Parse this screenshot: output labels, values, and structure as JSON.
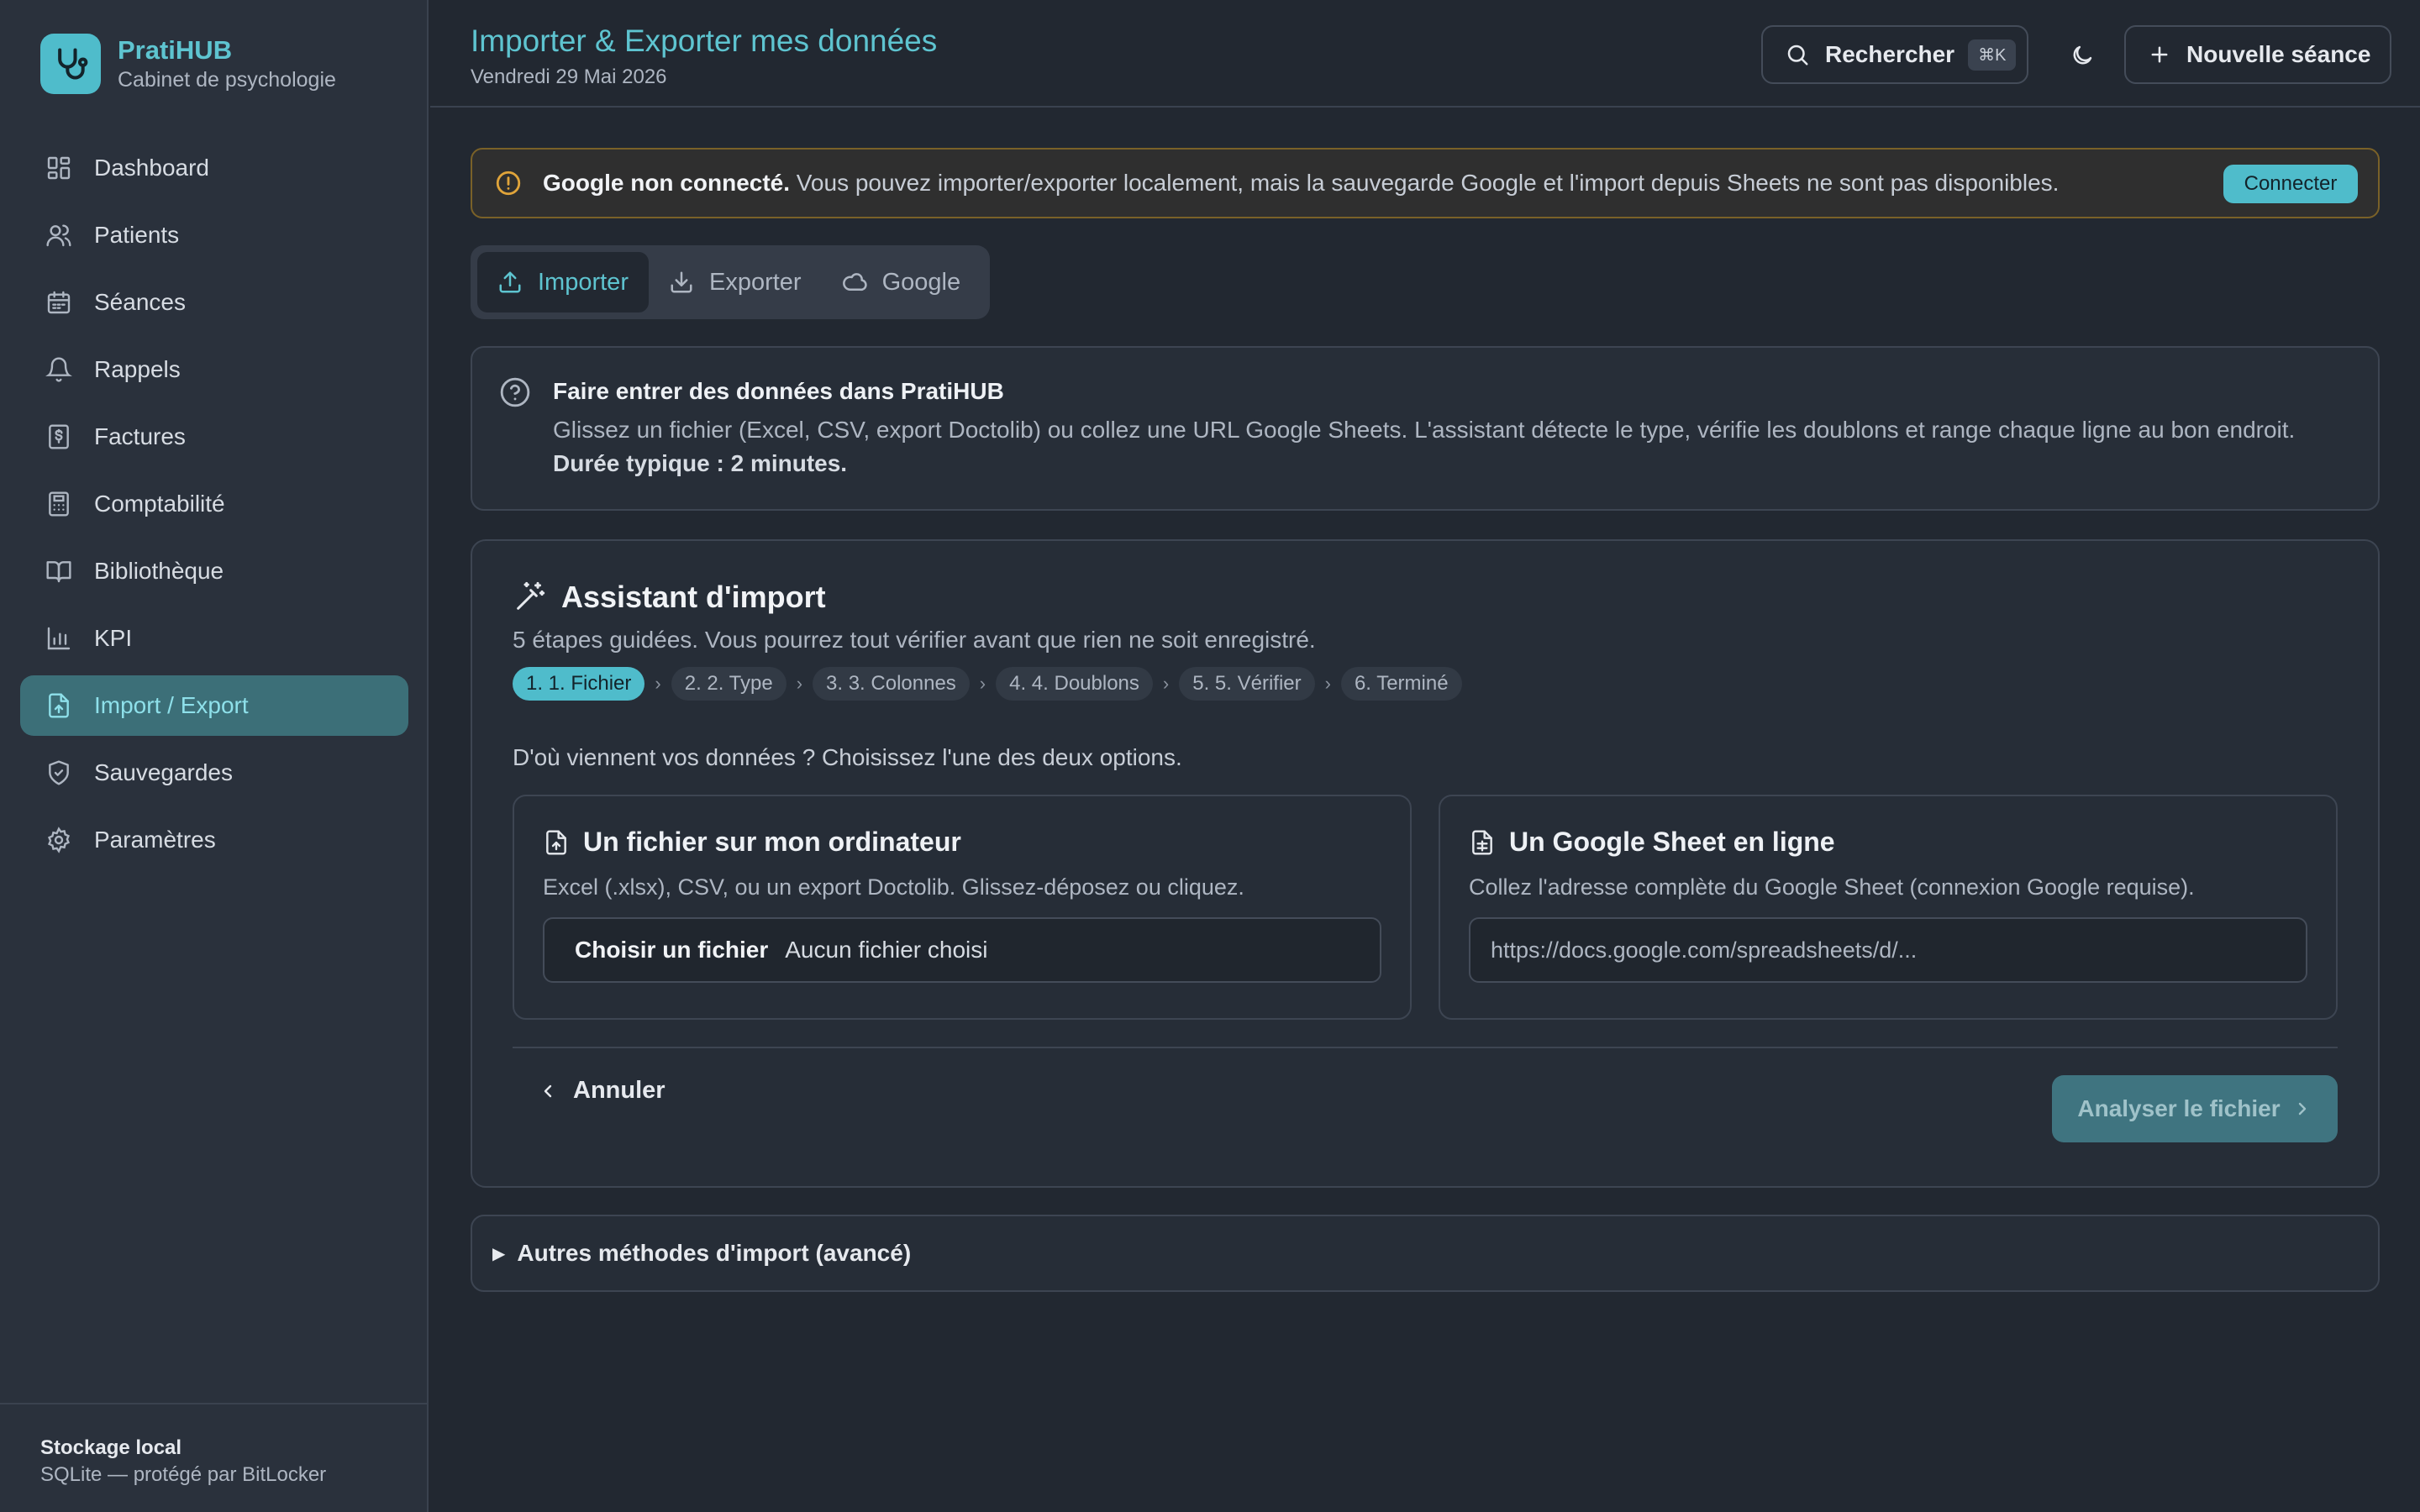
{
  "brand": {
    "name": "PratiHUB",
    "subtitle": "Cabinet de psychologie"
  },
  "nav": [
    {
      "label": "Dashboard",
      "icon": "dashboard-icon"
    },
    {
      "label": "Patients",
      "icon": "users-icon"
    },
    {
      "label": "Séances",
      "icon": "calendar-icon"
    },
    {
      "label": "Rappels",
      "icon": "bell-icon"
    },
    {
      "label": "Factures",
      "icon": "receipt-icon"
    },
    {
      "label": "Comptabilité",
      "icon": "calculator-icon"
    },
    {
      "label": "Bibliothèque",
      "icon": "book-icon"
    },
    {
      "label": "KPI",
      "icon": "bar-chart-icon"
    },
    {
      "label": "Import / Export",
      "icon": "file-import-icon",
      "active": true
    },
    {
      "label": "Sauvegardes",
      "icon": "shield-icon"
    },
    {
      "label": "Paramètres",
      "icon": "gear-icon"
    }
  ],
  "footer": {
    "title": "Stockage local",
    "subtitle": "SQLite — protégé par BitLocker"
  },
  "header": {
    "title": "Importer & Exporter mes données",
    "date": "Vendredi 29 Mai 2026",
    "search_label": "Rechercher",
    "search_shortcut": "⌘K",
    "new_session_label": "Nouvelle séance"
  },
  "alert": {
    "bold": "Google non connecté.",
    "text": " Vous pouvez importer/exporter localement, mais la sauvegarde Google et l'import depuis Sheets ne sont pas disponibles.",
    "button": "Connecter"
  },
  "tabs": [
    {
      "label": "Importer",
      "icon": "upload-icon",
      "active": true
    },
    {
      "label": "Exporter",
      "icon": "download-icon"
    },
    {
      "label": "Google",
      "icon": "cloud-icon"
    }
  ],
  "info": {
    "title": "Faire entrer des données dans PratiHUB",
    "body": "Glissez un fichier (Excel, CSV, export Doctolib) ou collez une URL Google Sheets. L'assistant détecte le type, vérifie les doublons et range chaque ligne au bon endroit. ",
    "body_bold": "Durée typique : 2 minutes."
  },
  "wizard": {
    "title": "Assistant d'import",
    "subtitle": "5 étapes guidées. Vous pourrez tout vérifier avant que rien ne soit enregistré.",
    "steps": [
      "1. 1. Fichier",
      "2. 2. Type",
      "3. 3. Colonnes",
      "4. 4. Doublons",
      "5. 5. Vérifier",
      "6. Terminé"
    ],
    "question": "D'où viennent vos données ? Choisissez l'une des deux options.",
    "file_option": {
      "title": "Un fichier sur mon ordinateur",
      "desc": "Excel (.xlsx), CSV, ou un export Doctolib. Glissez-déposez ou cliquez.",
      "choose_label": "Choisir un fichier",
      "no_file": "Aucun fichier choisi"
    },
    "sheet_option": {
      "title": "Un Google Sheet en ligne",
      "desc": "Collez l'adresse complète du Google Sheet (connexion Google requise).",
      "placeholder": "https://docs.google.com/spreadsheets/d/..."
    },
    "cancel_label": "Annuler",
    "analyze_label": "Analyser le fichier"
  },
  "advanced_label": "Autres méthodes d'import (avancé)",
  "colors": {
    "accent": "#4fbccb",
    "accent_text": "#5ec4d0",
    "warning": "#e0a43a",
    "background": "#222831"
  }
}
